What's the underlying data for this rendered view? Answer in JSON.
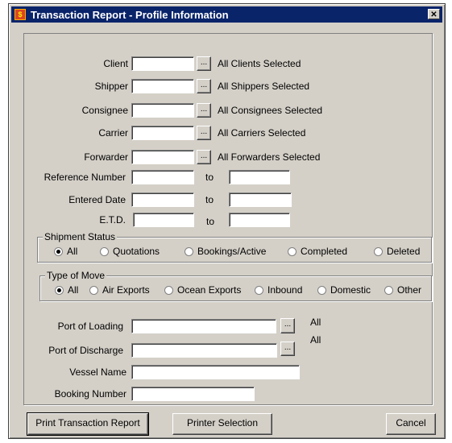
{
  "window": {
    "title": "Transaction Report - Profile Information",
    "close_glyph": "✕",
    "icon_glyph": "$"
  },
  "rows": [
    {
      "label": "Client",
      "note": "All Clients Selected"
    },
    {
      "label": "Shipper",
      "note": "All Shippers Selected"
    },
    {
      "label": "Consignee",
      "note": "All Consignees Selected"
    },
    {
      "label": "Carrier",
      "note": "All Carriers Selected"
    },
    {
      "label": "Forwarder",
      "note": "All Forwarders Selected"
    }
  ],
  "ranges": [
    {
      "label": "Reference Number",
      "to": "to"
    },
    {
      "label": "Entered Date",
      "to": "to"
    },
    {
      "label": "E.T.D.",
      "to": "to"
    }
  ],
  "dots_label": "...",
  "shipment_status": {
    "title": "Shipment Status",
    "options": [
      "All",
      "Quotations",
      "Bookings/Active",
      "Completed",
      "Deleted"
    ],
    "selected": "All"
  },
  "type_of_move": {
    "title": "Type of Move",
    "options": [
      "All",
      "Air Exports",
      "Ocean Exports",
      "Inbound",
      "Domestic",
      "Other"
    ],
    "selected": "All"
  },
  "ports": [
    {
      "label": "Port of  Loading",
      "note": "All"
    },
    {
      "label": "Port of Discharge",
      "note": "All"
    }
  ],
  "vessel": {
    "label": "Vessel Name"
  },
  "booking": {
    "label": "Booking Number"
  },
  "buttons": {
    "print": "Print Transaction Report",
    "printer": "Printer Selection",
    "cancel": "Cancel"
  }
}
